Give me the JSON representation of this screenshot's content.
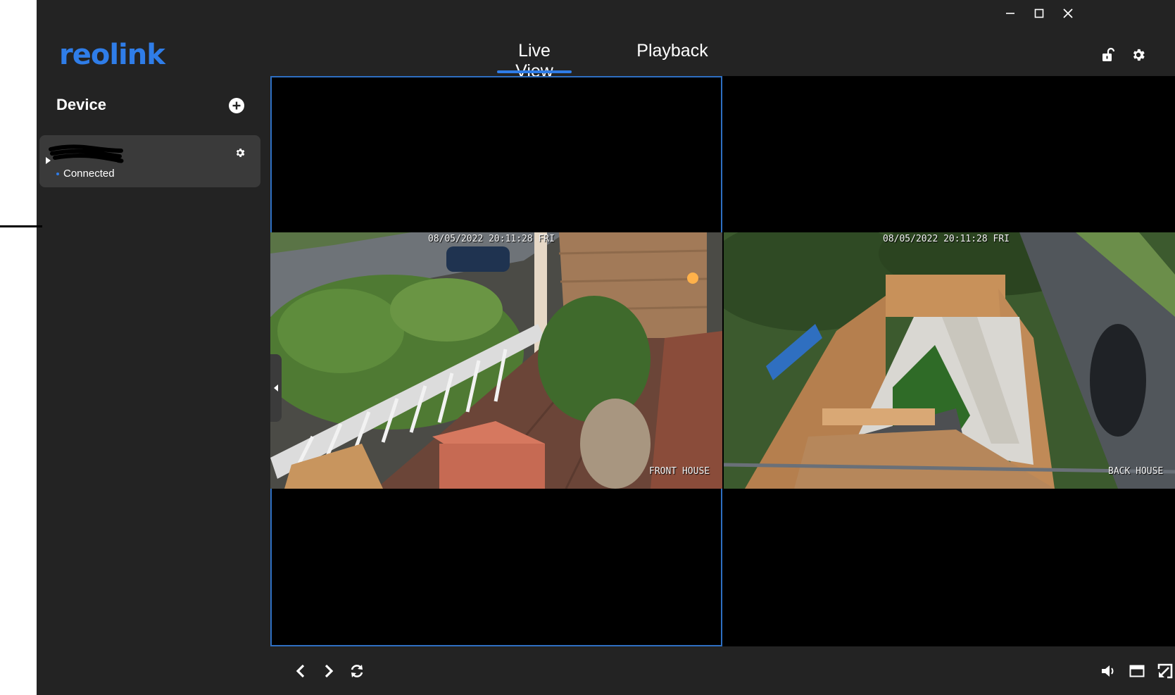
{
  "app": {
    "logo_text": "reolink"
  },
  "tabs": [
    {
      "label": "Live View",
      "active": true
    },
    {
      "label": "Playback",
      "active": false
    }
  ],
  "sidebar": {
    "title": "Device",
    "devices": [
      {
        "name": "",
        "status": "Connected",
        "status_color": "#2f7de8"
      }
    ]
  },
  "channels": [
    {
      "timestamp": "08/05/2022 20:11:28 FRI",
      "label": "FRONT HOUSE",
      "selected": true
    },
    {
      "timestamp": "08/05/2022 20:11:28 FRI",
      "label": "BACK HOUSE",
      "selected": false
    }
  ],
  "icons": {
    "window": [
      "minimize-icon",
      "maximize-icon",
      "close-icon"
    ],
    "header": [
      "unlock-icon",
      "settings-gear-icon"
    ],
    "toolbar_left": [
      "chevron-left-icon",
      "chevron-right-icon",
      "refresh-icon"
    ],
    "toolbar_right": [
      "volume-icon",
      "layout-icon",
      "fullscreen-icon"
    ]
  },
  "colors": {
    "accent": "#2f7de8",
    "background": "#232323",
    "card": "#3a3a3a",
    "selected_border": "#2e6fc2"
  }
}
